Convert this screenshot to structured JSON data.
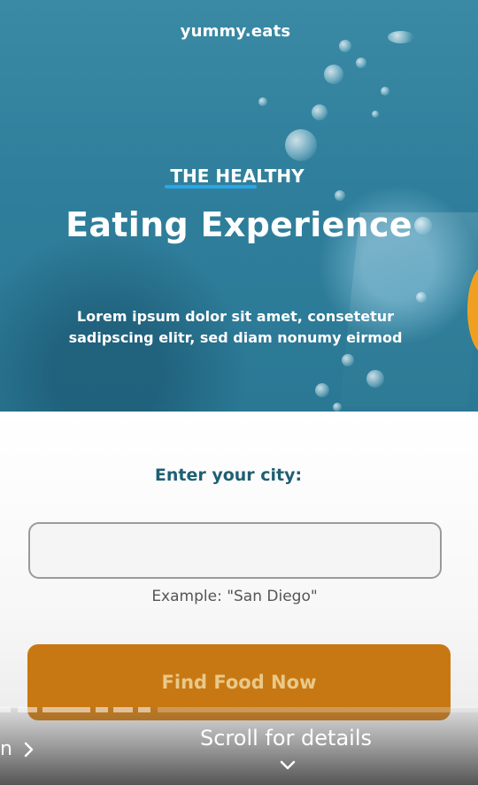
{
  "hero": {
    "brand": "yummy.eats",
    "eyebrow": "THE HEALTHY",
    "headline": "Eating Experience",
    "lead_line1": "Lorem ipsum dolor sit amet, consetetur",
    "lead_line2": "sadipscing elitr, sed diam nonumy eirmod"
  },
  "form": {
    "city_label": "Enter your city:",
    "city_value": "",
    "city_hint": "Example: \"San Diego\"",
    "button_label": "Find Food Now"
  },
  "overlay": {
    "prev_label": "n",
    "scroll_hint": "Scroll for details"
  },
  "colors": {
    "hero_bg": "#2f7f9c",
    "accent_underline": "#2aa6e8",
    "label_text": "#1f5f73",
    "button_bg": "#c87812",
    "button_text": "#e8c98a"
  },
  "icons": {
    "prev": "chevron-right-icon",
    "scroll": "chevron-down-icon"
  }
}
